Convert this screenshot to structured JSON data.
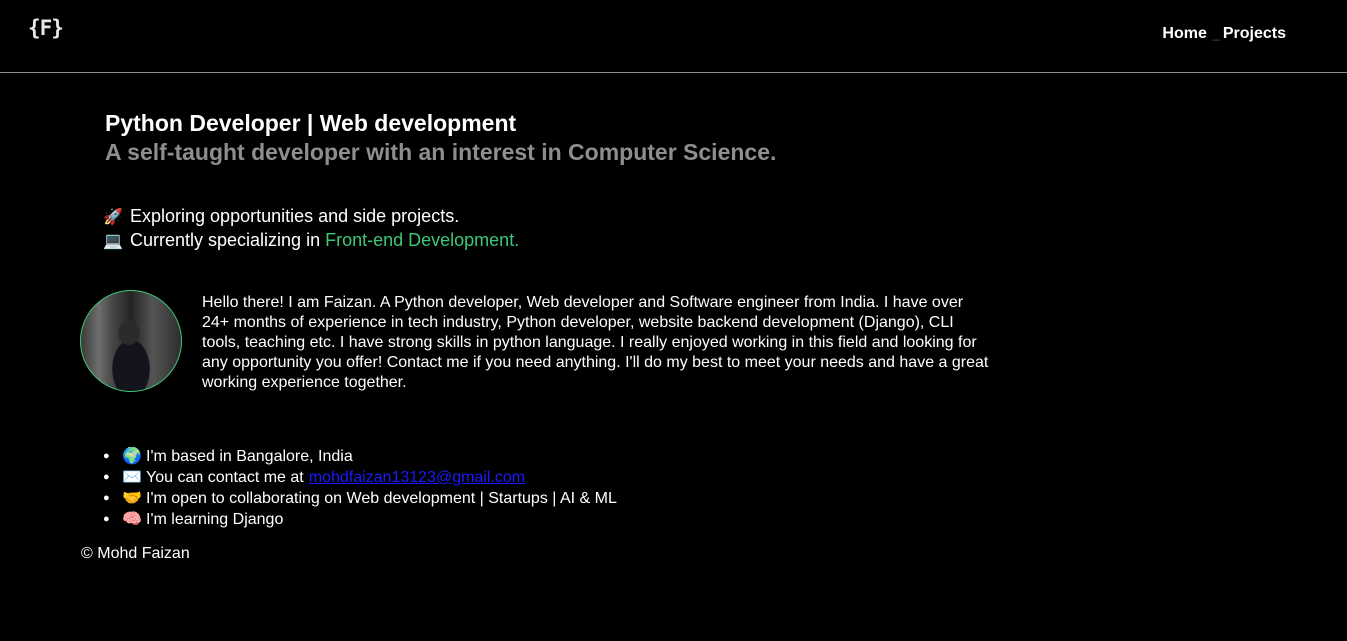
{
  "header": {
    "logo": "{F}",
    "nav": {
      "home": "Home",
      "separator": "_",
      "projects": "Projects"
    }
  },
  "hero": {
    "title": "Python Developer | Web development",
    "subtitle": "A self-taught developer with an interest in Computer Science."
  },
  "status": {
    "line1_emoji": "🚀",
    "line1_text": "Exploring opportunities and side projects.",
    "line2_emoji": "💻",
    "line2_text": "Currently specializing in ",
    "line2_highlight": "Front-end Development."
  },
  "about": {
    "bio": "Hello there! I am Faizan. A Python developer, Web developer and Software engineer from India. I have over 24+ months of experience in tech industry, Python developer, website backend development (Django), CLI tools, teaching etc. I have strong skills in python language. I really enjoyed working in this field and looking for any opportunity you offer! Contact me if you need anything. I'll do my best to meet your needs and have a great working experience together."
  },
  "facts": [
    {
      "emoji": "🌍",
      "text": "I'm based in Bangalore, India"
    },
    {
      "emoji": "✉️",
      "text": "You can contact me at",
      "link": "mohdfaizan13123@gmail.com"
    },
    {
      "emoji": "🤝",
      "text": "I'm open to collaborating on Web development | Startups | AI & ML"
    },
    {
      "emoji": "🧠",
      "text": "I'm learning Django"
    }
  ],
  "footer": {
    "text": "© Mohd Faizan"
  },
  "colors": {
    "background": "#000000",
    "accent_green": "#3cc878",
    "subtitle_gray": "#8e8e8e",
    "link_blue": "#1a1aff"
  }
}
